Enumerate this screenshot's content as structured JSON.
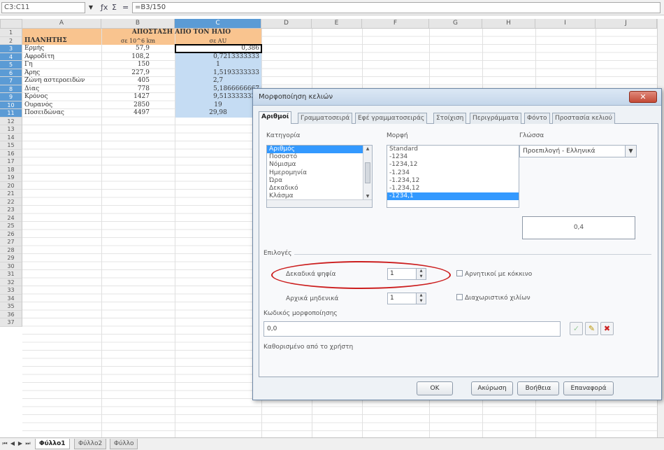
{
  "formula_bar": {
    "cell_ref": "C3:C11",
    "formula": "=B3/150",
    "icons": [
      "function-wizard-icon",
      "sum-icon",
      "equals-icon"
    ]
  },
  "sheet": {
    "columns": [
      "A",
      "B",
      "C",
      "D",
      "E",
      "F",
      "G",
      "H",
      "I",
      "J"
    ],
    "selected_column": "C",
    "rows": [
      "1",
      "2",
      "3",
      "4",
      "5",
      "6",
      "7",
      "8",
      "9",
      "10",
      "11",
      "12",
      "13",
      "14",
      "15",
      "16",
      "17",
      "18",
      "19",
      "20",
      "21",
      "22",
      "23",
      "24",
      "25",
      "26",
      "27",
      "28",
      "29",
      "30",
      "31",
      "32",
      "33",
      "34",
      "35",
      "36",
      "37"
    ],
    "header_title": "ΑΠΟΣΤΑΣΗ ΑΠΟ ΤΟΝ ΗΛΙΟ",
    "col_a_header": "ΠΛΑΝΗΤΗΣ",
    "col_b_header": "σε 10^6 km",
    "col_c_header": "σε AU",
    "data": [
      {
        "a": "Ερμής",
        "b": "57,9",
        "c": "0,386"
      },
      {
        "a": "Αφροδίτη",
        "b": "108,2",
        "c": "0,7213333333"
      },
      {
        "a": "Γη",
        "b": "150",
        "c": "1"
      },
      {
        "a": "Άρης",
        "b": "227,9",
        "c": "1,5193333333"
      },
      {
        "a": "Ζώνη αστεροειδών",
        "b": "405",
        "c": "2,7"
      },
      {
        "a": "Δίας",
        "b": "778",
        "c": "5,1866666667"
      },
      {
        "a": "Κρόνος",
        "b": "1427",
        "c": "9,5133333333"
      },
      {
        "a": "Ουρανός",
        "b": "2850",
        "c": "19"
      },
      {
        "a": "Ποσειδώνας",
        "b": "4497",
        "c": "29,98"
      }
    ],
    "tabs": [
      "Φύλλο1",
      "Φύλλο2",
      "Φύλλο"
    ],
    "active_tab": "Φύλλο1"
  },
  "dialog": {
    "title": "Μορφοποίηση κελιών",
    "close_label": "✕",
    "tabs": [
      "Αριθμοί",
      "Γραμματοσειρά",
      "Εφέ γραμματοσειράς",
      "Στοίχιση",
      "Περιγράμματα",
      "Φόντο",
      "Προστασία κελιού"
    ],
    "active_tab": "Αριθμοί",
    "category_label": "Κατηγορία",
    "categories": [
      "Αριθμός",
      "Ποσοστό",
      "Νόμισμα",
      "Ημερομηνία",
      "Ώρα",
      "Δεκαδικό",
      "Κλάσμα"
    ],
    "selected_category": "Αριθμός",
    "format_label": "Μορφή",
    "formats": [
      "Standard",
      "-1234",
      "-1234,12",
      "-1.234",
      "-1.234,12",
      "-1.234,12",
      "-1234,1"
    ],
    "selected_format": "-1234,1",
    "language_label": "Γλώσσα",
    "language_value": "Προεπιλογή - Ελληνικά",
    "preview_value": "0,4",
    "options_label": "Επιλογές",
    "decimals_label": "Δεκαδικά ψηφία",
    "decimals_value": "1",
    "leading_zeros_label": "Αρχικά μηδενικά",
    "leading_zeros_value": "1",
    "negative_red_label": "Αρνητικοί με κόκκινο",
    "thousands_sep_label": "Διαχωριστικό χιλίων",
    "format_code_label": "Κωδικός μορφοποίησης",
    "format_code_value": "0,0",
    "user_defined_label": "Καθορισμένο από το χρήστη",
    "buttons": {
      "ok": "OK",
      "cancel": "Ακύρωση",
      "help": "Βοήθεια",
      "reset": "Επαναφορά"
    }
  }
}
